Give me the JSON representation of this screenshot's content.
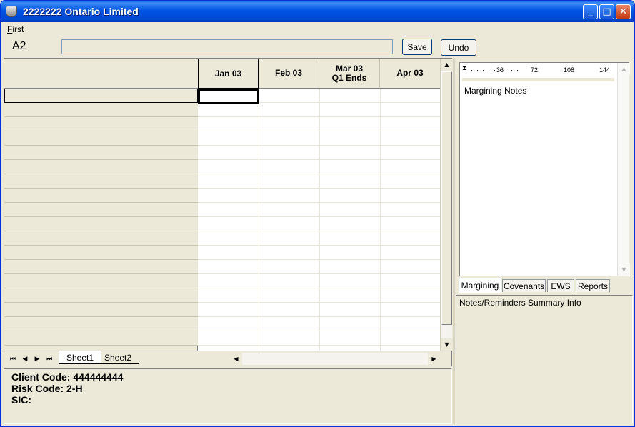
{
  "window": {
    "title": "2222222 Ontario Limited"
  },
  "menu": {
    "items": [
      "First"
    ]
  },
  "formula": {
    "cell_ref": "A2",
    "value": "",
    "save_label": "Save",
    "undo_label": "Undo"
  },
  "grid": {
    "columns": [
      "Jan 03",
      "Feb 03",
      "Mar 03\nQ1 Ends",
      "Apr 03"
    ],
    "row_count": 18
  },
  "sheets": {
    "tabs": [
      "Sheet1",
      "Sheet2"
    ],
    "active": "Sheet1"
  },
  "info": {
    "client_code": "Client Code:  444444444",
    "risk_code": "Risk Code:  2-H",
    "sic": "SIC:"
  },
  "notes": {
    "ruler_marks": [
      "36",
      "72",
      "108",
      "144"
    ],
    "title": "Margining Notes",
    "tabs": [
      "Margining",
      "Covenants",
      "EWS",
      "Reports"
    ],
    "active_tab": "Margining",
    "summary_title": "Notes/Reminders Summary Info"
  },
  "colors": {
    "title_bar": "#0055E5",
    "face": "#ECE9D8",
    "close_button": "#C43A12"
  }
}
